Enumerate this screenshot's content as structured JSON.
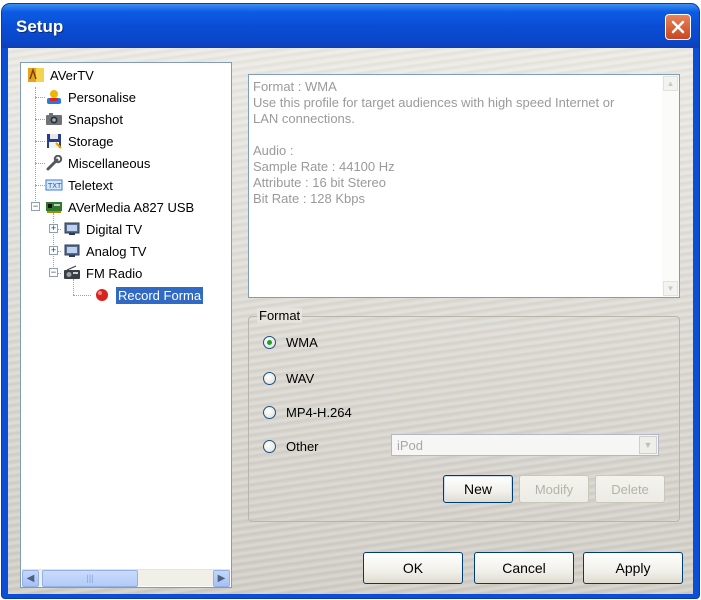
{
  "window": {
    "title": "Setup"
  },
  "tree": {
    "root": "AVerTV",
    "items": [
      "Personalise",
      "Snapshot",
      "Storage",
      "Miscellaneous",
      "Teletext"
    ],
    "device": "AVerMedia A827 USB",
    "device_children": [
      "Digital TV",
      "Analog TV",
      "FM Radio"
    ],
    "selected": "Record Forma",
    "scroll_thumb": "|||"
  },
  "info": {
    "lines": [
      "Format : WMA",
      "Use this profile for target audiences with high speed Internet or",
      "LAN connections.",
      "",
      "Audio :",
      "Sample Rate : 44100 Hz",
      "Attribute : 16 bit Stereo",
      "Bit Rate : 128 Kbps"
    ]
  },
  "format": {
    "group_title": "Format",
    "options": [
      "WMA",
      "WAV",
      "MP4-H.264",
      "Other"
    ],
    "selected_option": "WMA",
    "other_combo_value": "iPod",
    "buttons": {
      "new": "New",
      "modify": "Modify",
      "delete": "Delete"
    }
  },
  "dialog_buttons": {
    "ok": "OK",
    "cancel": "Cancel",
    "apply": "Apply"
  },
  "colors": {
    "title_bar": "#0a4cd4",
    "selection": "#316ac5",
    "close": "#c8471f"
  }
}
